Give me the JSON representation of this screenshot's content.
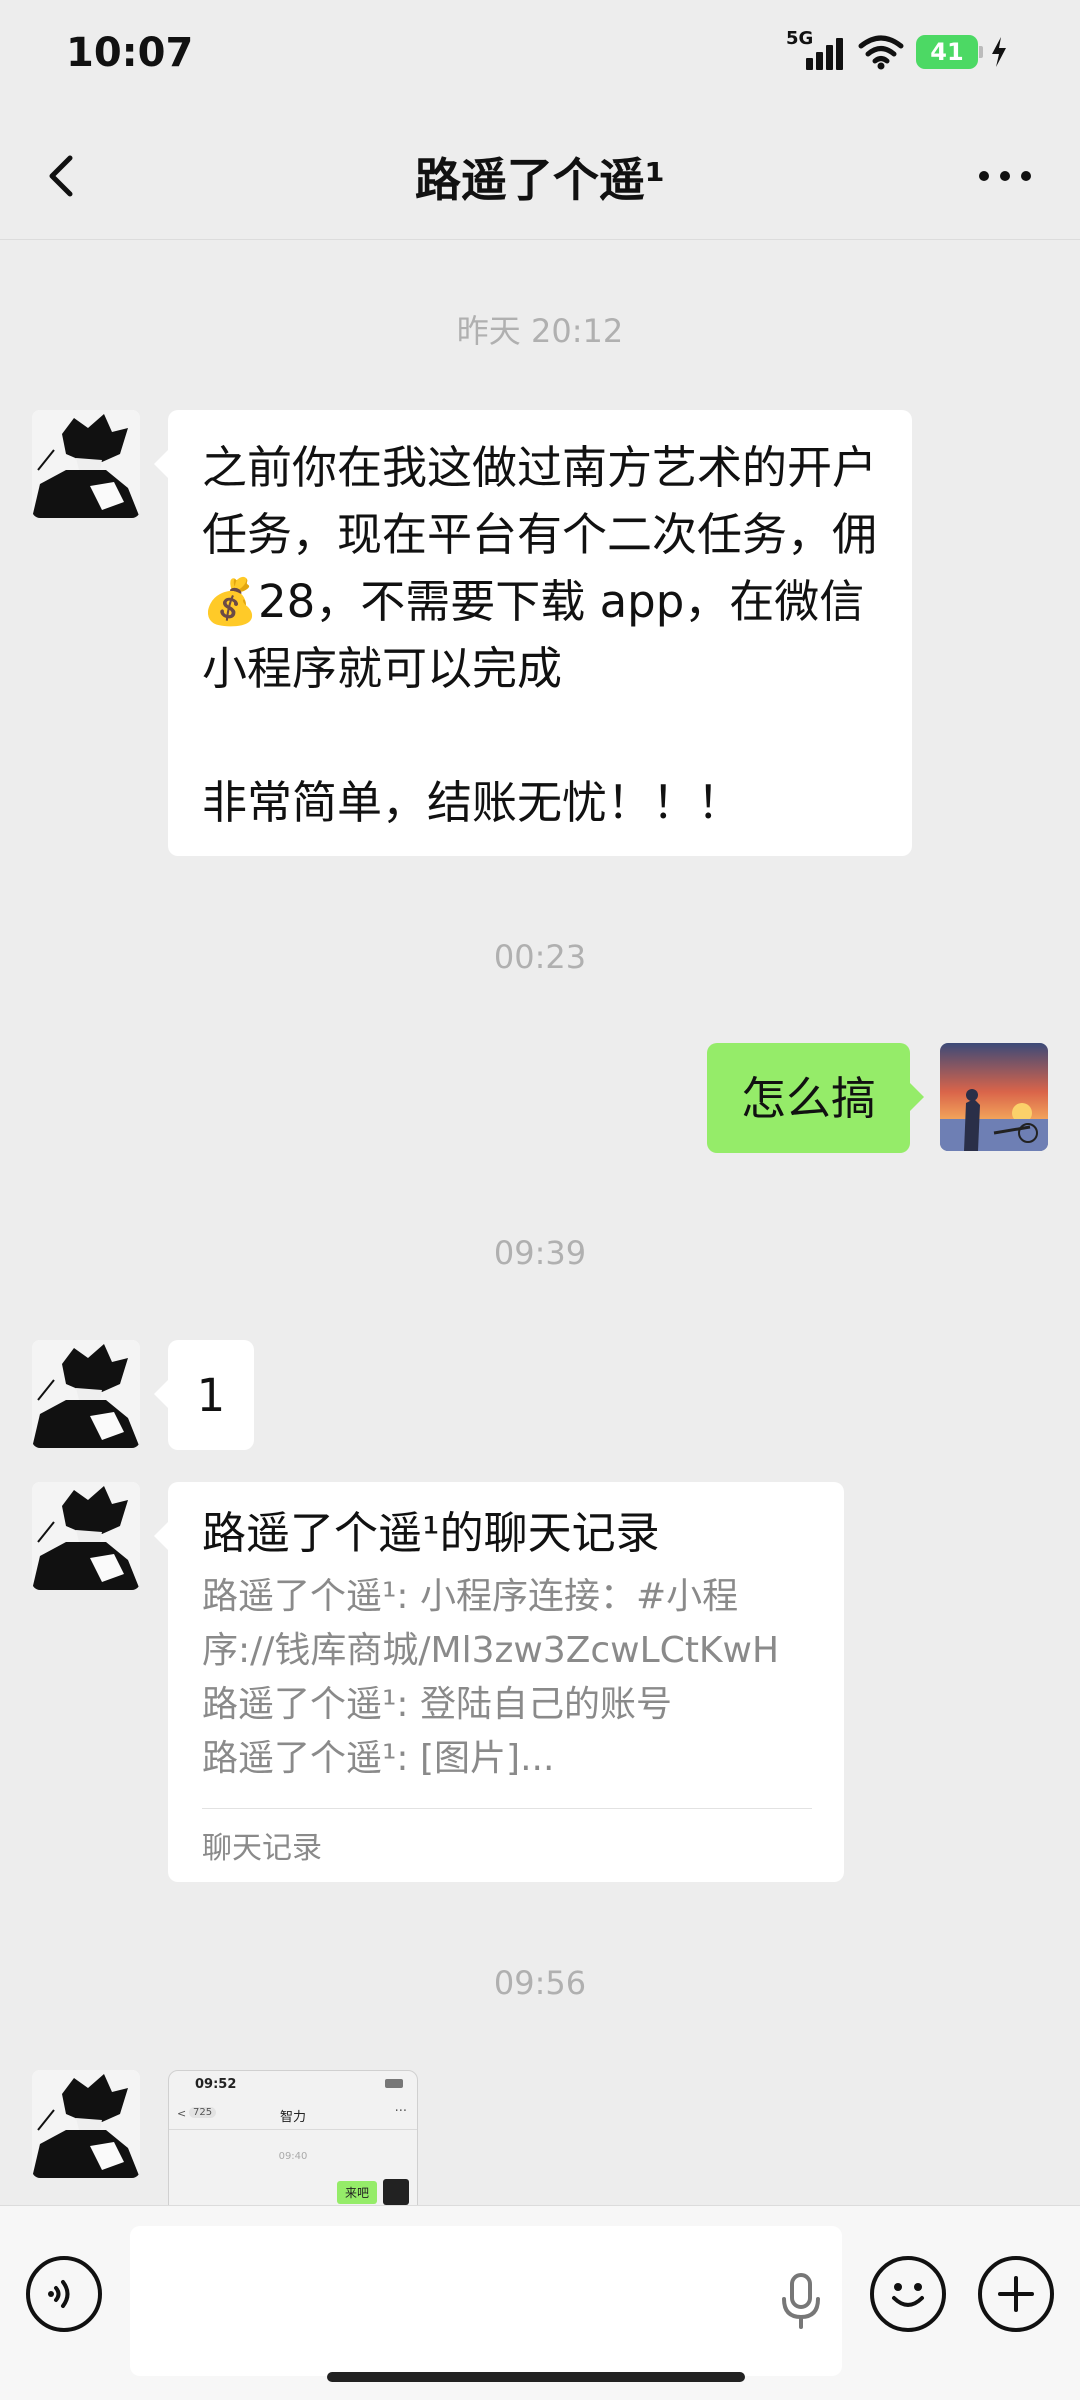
{
  "status_bar": {
    "time": "10:07",
    "network": "5G",
    "battery": "41"
  },
  "header": {
    "title": "路遥了个遥¹"
  },
  "messages": [
    {
      "kind": "timestamp",
      "text": "昨天 20:12"
    },
    {
      "kind": "incoming-text",
      "lines": [
        "之前你在我这做过南方艺术的开户",
        "任务，现在平台有个二次任务，佣",
        "💰28，不需要下载 app，在微信",
        "小程序就可以完成",
        "",
        "非常简单，结账无忧！！！"
      ]
    },
    {
      "kind": "timestamp",
      "text": "00:23"
    },
    {
      "kind": "outgoing-text",
      "text": "怎么搞"
    },
    {
      "kind": "timestamp",
      "text": "09:39"
    },
    {
      "kind": "incoming-text",
      "text": "1"
    },
    {
      "kind": "chat-record",
      "title": "路遥了个遥¹的聊天记录",
      "lines": [
        "路遥了个遥¹: 小程序连接：#小程",
        "序://钱库商城/Ml3zw3ZcwLCtKwH",
        "路遥了个遥¹: 登陆自己的账号",
        "路遥了个遥¹: [图片]..."
      ],
      "footer": "聊天记录"
    },
    {
      "kind": "timestamp",
      "text": "09:56"
    },
    {
      "kind": "incoming-image",
      "thumb": {
        "time": "09:52",
        "back_count": "725",
        "title": "智力",
        "stamp": "09:40",
        "bubble": "来吧"
      }
    }
  ],
  "colors": {
    "background": "#ededed",
    "outgoing_bubble": "#95ec69",
    "incoming_bubble": "#ffffff",
    "timestamp": "#b0b0b0"
  },
  "icons": [
    "back-icon",
    "more-icon",
    "voice-mode-icon",
    "microphone-icon",
    "emoji-icon",
    "plus-icon"
  ]
}
